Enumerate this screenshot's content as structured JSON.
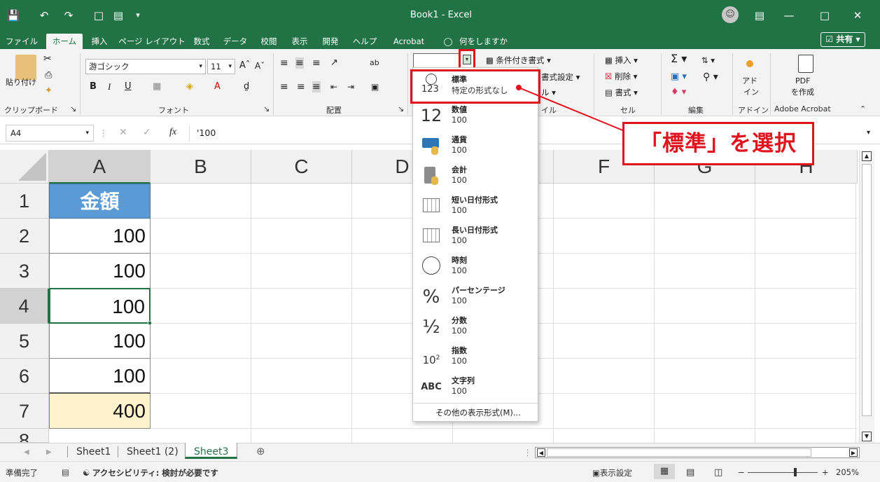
{
  "window": {
    "title": "Book1 - Excel"
  },
  "quick_access": [
    "save-icon",
    "undo-icon",
    "redo-icon",
    "new-doc-icon",
    "form-icon",
    "customize-icon"
  ],
  "tabs": [
    "ファイル",
    "ホーム",
    "挿入",
    "ページ レイアウト",
    "数式",
    "データ",
    "校閲",
    "表示",
    "開発",
    "ヘルプ",
    "Acrobat"
  ],
  "tell_me": "何をしますか",
  "share_label": "共有",
  "ribbon": {
    "clipboard": {
      "paste": "貼り付け",
      "label": "クリップボード"
    },
    "font": {
      "name": "游ゴシック",
      "size": "11",
      "label": "フォント",
      "bold": "B",
      "italic": "I",
      "underline": "U"
    },
    "alignment": {
      "label": "配置"
    },
    "styles": {
      "conditional": "条件付き書式",
      "table": "書式設定",
      "cell": "ル",
      "label": "イル"
    },
    "cells": {
      "insert": "挿入",
      "delete": "削除",
      "format": "書式",
      "label": "セル"
    },
    "editing": {
      "label": "編集"
    },
    "addins": {
      "line1": "アド",
      "line2": "イン",
      "label": "アドイン"
    },
    "acrobat": {
      "line1": "PDF",
      "line2": "を作成",
      "label": "Adobe Acrobat"
    }
  },
  "formula_bar": {
    "name_box": "A4",
    "fx": "fx",
    "value": "'100"
  },
  "columns": [
    "A",
    "B",
    "C",
    "D",
    "E",
    "F",
    "G",
    "H"
  ],
  "rows": [
    {
      "num": "1",
      "value": "金額"
    },
    {
      "num": "2",
      "value": "100"
    },
    {
      "num": "3",
      "value": "100"
    },
    {
      "num": "4",
      "value": "100"
    },
    {
      "num": "5",
      "value": "100"
    },
    {
      "num": "6",
      "value": "100"
    },
    {
      "num": "7",
      "value": "400"
    },
    {
      "num": "8",
      "value": ""
    }
  ],
  "colors": {
    "excel_green": "#217346",
    "header_fill": "#5b9bd5",
    "total_fill": "#fff2cc",
    "annotation_red": "#e0141e"
  },
  "number_formats": [
    {
      "icon": "clock-123-icon",
      "name": "標準",
      "value": "特定の形式なし"
    },
    {
      "icon": "number-12-icon",
      "name": "数値",
      "value": "100"
    },
    {
      "icon": "currency-icon",
      "name": "通貨",
      "value": "100"
    },
    {
      "icon": "accounting-icon",
      "name": "会計",
      "value": " 100"
    },
    {
      "icon": "calendar-short-icon",
      "name": "短い日付形式",
      "value": "100"
    },
    {
      "icon": "calendar-long-icon",
      "name": "長い日付形式",
      "value": "100"
    },
    {
      "icon": "clock-icon",
      "name": "時刻",
      "value": "100"
    },
    {
      "icon": "percent-icon",
      "name": "パーセンテージ",
      "value": "100"
    },
    {
      "icon": "fraction-icon",
      "name": "分数",
      "value": "100"
    },
    {
      "icon": "scientific-icon",
      "name": "指数",
      "value": "100"
    },
    {
      "icon": "text-abc-icon",
      "name": "文字列",
      "value": "100"
    }
  ],
  "more_formats": "その他の表示形式(M)...",
  "annotation": "「標準」を選択",
  "sheets": [
    "Sheet1",
    "Sheet1 (2)",
    "Sheet3"
  ],
  "active_sheet": "Sheet3",
  "status": {
    "ready": "準備完了",
    "accessibility": "アクセシビリティ: 検討が必要です",
    "display_settings": "表示設定",
    "zoom": "205%"
  }
}
